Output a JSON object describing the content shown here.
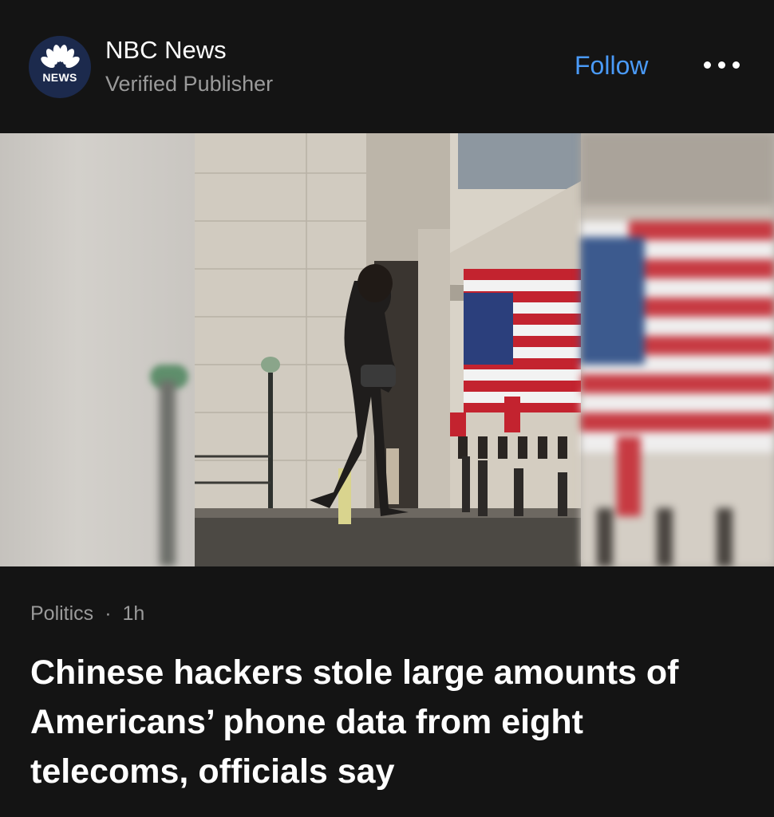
{
  "publisher": {
    "logo_label": "NEWS",
    "name": "NBC News",
    "subtitle": "Verified Publisher"
  },
  "actions": {
    "follow_label": "Follow",
    "more_icon": "ellipsis-icon"
  },
  "hero_image": {
    "description_icon": "photo-icon"
  },
  "article": {
    "category": "Politics",
    "separator": "·",
    "time": "1h",
    "headline": "Chinese hackers stole large amounts of Americans’ phone data from eight telecoms, officials say"
  },
  "colors": {
    "background": "#141414",
    "accent": "#4a9af7",
    "secondary_text": "#9a9a9a"
  }
}
